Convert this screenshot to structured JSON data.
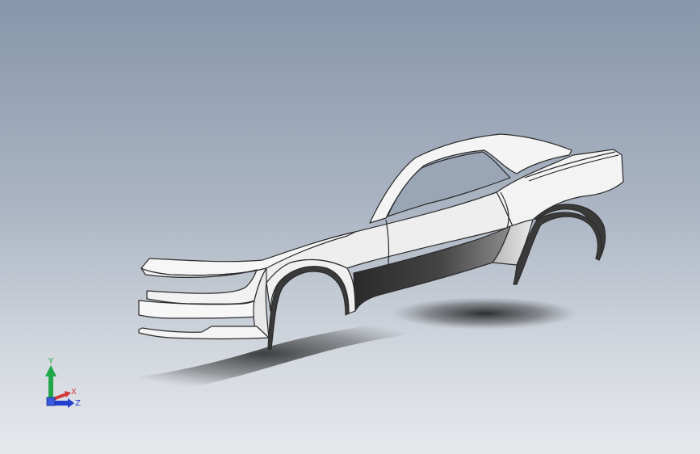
{
  "viewport": {
    "background_top": "#8796ab",
    "background_bottom": "#e6e8ec"
  },
  "model": {
    "body_color": "#f1f1f1",
    "edge_color": "#2b2b2b",
    "side_panel_dark": "#3a3a3a",
    "side_panel_light": "#9a9a9a"
  },
  "triad": {
    "y_label": "Y",
    "x_label": "X",
    "z_label": "Z",
    "y_color": "#22a84a",
    "x_color": "#d23a3a",
    "z_color": "#2040d0"
  }
}
